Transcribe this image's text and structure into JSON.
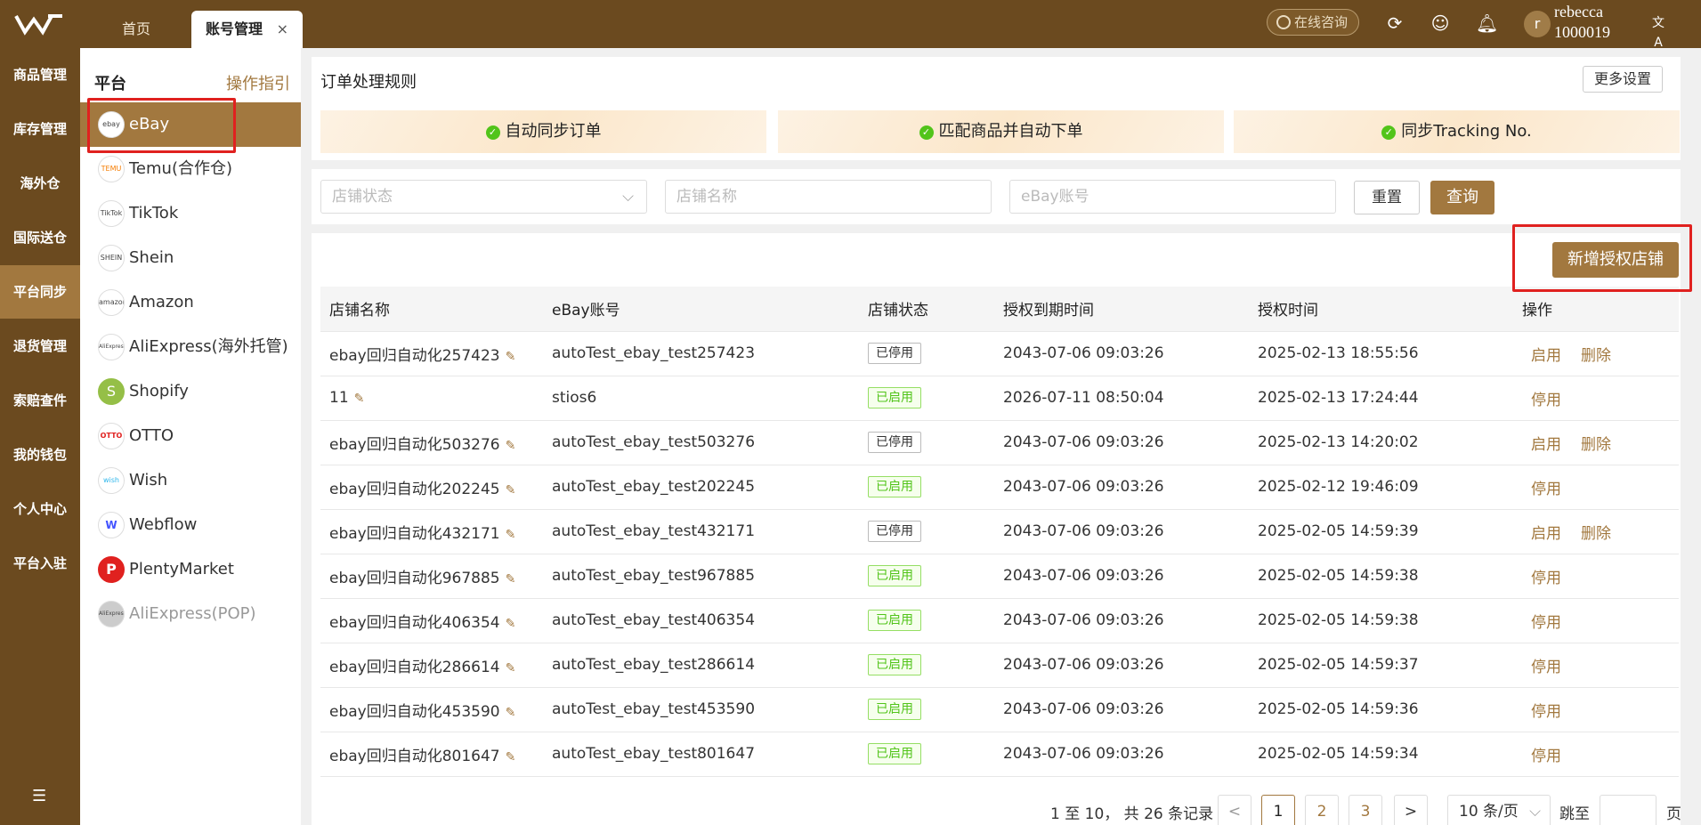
{
  "topbar": {
    "tabs": [
      {
        "label": "首页"
      },
      {
        "label": "账号管理"
      }
    ],
    "tab_close": "×",
    "consult_label": "在线咨询",
    "avatar_initial": "r",
    "username": "rebecca",
    "user_id": "1000019",
    "lang_icon": "文A"
  },
  "leftnav": {
    "items": [
      {
        "label": "商品管理"
      },
      {
        "label": "库存管理"
      },
      {
        "label": "海外仓"
      },
      {
        "label": "国际送仓"
      },
      {
        "label": "平台同步"
      },
      {
        "label": "退货管理"
      },
      {
        "label": "索赔查件"
      },
      {
        "label": "我的钱包"
      },
      {
        "label": "个人中心"
      },
      {
        "label": "平台入驻"
      }
    ],
    "active_index": 4
  },
  "platforms": {
    "title": "平台",
    "guide_link": "操作指引",
    "items": [
      {
        "label": "eBay",
        "logo": "ebay"
      },
      {
        "label": "Temu(合作仓)",
        "logo": "TEMU"
      },
      {
        "label": "TikTok",
        "logo": "TikTok"
      },
      {
        "label": "Shein",
        "logo": "SHEIN"
      },
      {
        "label": "Amazon",
        "logo": "amazon"
      },
      {
        "label": "AliExpress(海外托管)",
        "logo": "AliExpress"
      },
      {
        "label": "Shopify",
        "logo": "S"
      },
      {
        "label": "OTTO",
        "logo": "OTTO"
      },
      {
        "label": "Wish",
        "logo": "wish"
      },
      {
        "label": "Webflow",
        "logo": "W"
      },
      {
        "label": "PlentyMarket",
        "logo": "P"
      },
      {
        "label": "AliExpress(POP)",
        "logo": "AliExpress"
      }
    ]
  },
  "rules": {
    "title": "订单处理规则",
    "more_settings": "更多设置",
    "cards": [
      {
        "label": "自动同步订单"
      },
      {
        "label": "匹配商品并自动下单"
      },
      {
        "label": "同步Tracking No."
      }
    ]
  },
  "filters": {
    "status_placeholder": "店铺状态",
    "name_placeholder": "店铺名称",
    "account_placeholder": "eBay账号",
    "reset": "重置",
    "query": "查询"
  },
  "add_store": "新增授权店铺",
  "table": {
    "headers": [
      "店铺名称",
      "eBay账号",
      "店铺状态",
      "授权到期时间",
      "授权时间",
      "操作"
    ],
    "rows": [
      {
        "name": "ebay回归自动化257423",
        "account": "autoTest_ebay_test257423",
        "status": "已停用",
        "expire": "2043-07-06 09:03:26",
        "auth": "2025-02-13 18:55:56",
        "ops": [
          "启用",
          "删除"
        ]
      },
      {
        "name": "11",
        "account": "stios6",
        "status": "已启用",
        "expire": "2026-07-11 08:50:04",
        "auth": "2025-02-13 17:24:44",
        "ops": [
          "停用"
        ]
      },
      {
        "name": "ebay回归自动化503276",
        "account": "autoTest_ebay_test503276",
        "status": "已停用",
        "expire": "2043-07-06 09:03:26",
        "auth": "2025-02-13 14:20:02",
        "ops": [
          "启用",
          "删除"
        ]
      },
      {
        "name": "ebay回归自动化202245",
        "account": "autoTest_ebay_test202245",
        "status": "已启用",
        "expire": "2043-07-06 09:03:26",
        "auth": "2025-02-12 19:46:09",
        "ops": [
          "停用"
        ]
      },
      {
        "name": "ebay回归自动化432171",
        "account": "autoTest_ebay_test432171",
        "status": "已停用",
        "expire": "2043-07-06 09:03:26",
        "auth": "2025-02-05 14:59:39",
        "ops": [
          "启用",
          "删除"
        ]
      },
      {
        "name": "ebay回归自动化967885",
        "account": "autoTest_ebay_test967885",
        "status": "已启用",
        "expire": "2043-07-06 09:03:26",
        "auth": "2025-02-05 14:59:38",
        "ops": [
          "停用"
        ]
      },
      {
        "name": "ebay回归自动化406354",
        "account": "autoTest_ebay_test406354",
        "status": "已启用",
        "expire": "2043-07-06 09:03:26",
        "auth": "2025-02-05 14:59:38",
        "ops": [
          "停用"
        ]
      },
      {
        "name": "ebay回归自动化286614",
        "account": "autoTest_ebay_test286614",
        "status": "已启用",
        "expire": "2043-07-06 09:03:26",
        "auth": "2025-02-05 14:59:37",
        "ops": [
          "停用"
        ]
      },
      {
        "name": "ebay回归自动化453590",
        "account": "autoTest_ebay_test453590",
        "status": "已启用",
        "expire": "2043-07-06 09:03:26",
        "auth": "2025-02-05 14:59:36",
        "ops": [
          "停用"
        ]
      },
      {
        "name": "ebay回归自动化801647",
        "account": "autoTest_ebay_test801647",
        "status": "已启用",
        "expire": "2043-07-06 09:03:26",
        "auth": "2025-02-05 14:59:34",
        "ops": [
          "停用"
        ]
      }
    ]
  },
  "pagination": {
    "info": "1 至 10， 共 26 条记录",
    "pages": [
      "1",
      "2",
      "3"
    ],
    "current": "1",
    "prev": "<",
    "next": ">",
    "page_size": "10 条/页",
    "jump_label": "跳至",
    "page_suffix": "页"
  },
  "colors": {
    "brand": "#6b4a1f",
    "accent": "#a2783f",
    "active_status": "#52c41a",
    "highlight": "#e0211f"
  }
}
